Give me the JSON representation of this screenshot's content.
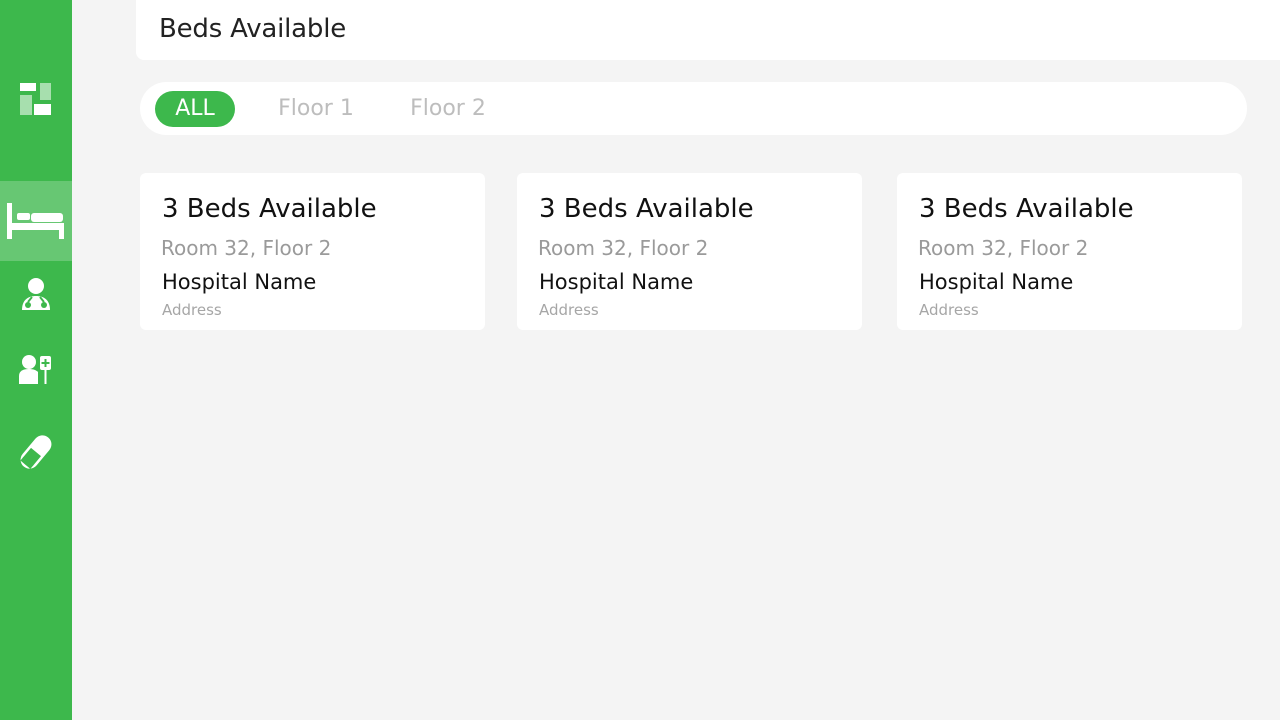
{
  "colors": {
    "accent": "#3db84c",
    "background": "#f4f4f4",
    "card": "#ffffff",
    "muted_text": "#9a9a9a",
    "inactive_tab": "#bdbdbd"
  },
  "sidebar": {
    "logo_icon": "app-logo-icon",
    "items": [
      {
        "icon": "bed-icon",
        "active": true
      },
      {
        "icon": "doctor-icon",
        "active": false
      },
      {
        "icon": "patient-iv-icon",
        "active": false
      },
      {
        "icon": "pill-icon",
        "active": false
      }
    ]
  },
  "header": {
    "title": "Beds Available"
  },
  "tabs": [
    {
      "label": "ALL",
      "active": true
    },
    {
      "label": "Floor 1",
      "active": false
    },
    {
      "label": "Floor 2",
      "active": false
    }
  ],
  "cards": [
    {
      "beds": "3 Beds Available",
      "room": "Room 32, Floor 2",
      "hospital": "Hospital Name",
      "address": "Address"
    },
    {
      "beds": "3 Beds Available",
      "room": "Room 32, Floor 2",
      "hospital": "Hospital Name",
      "address": "Address"
    },
    {
      "beds": "3 Beds Available",
      "room": "Room 32, Floor 2",
      "hospital": "Hospital Name",
      "address": "Address"
    }
  ]
}
